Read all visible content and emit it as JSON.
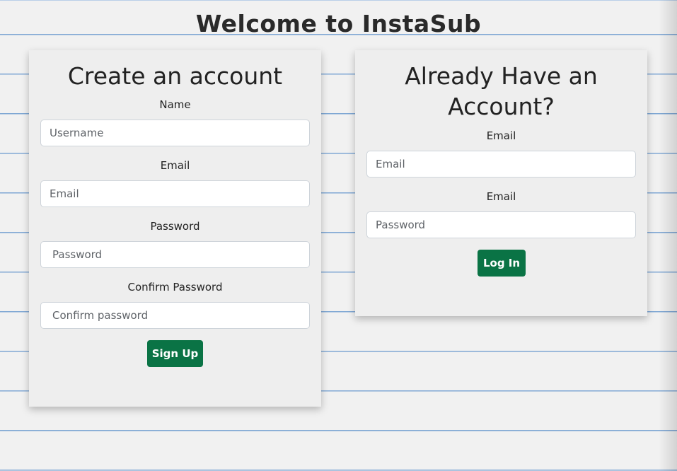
{
  "page": {
    "title": "Welcome to InstaSub"
  },
  "signup": {
    "heading": "Create an account",
    "fields": [
      {
        "label": "Name",
        "placeholder": "Username",
        "value": ""
      },
      {
        "label": "Email",
        "placeholder": "Email",
        "value": ""
      },
      {
        "label": "Password",
        "placeholder": "Password",
        "value": ""
      },
      {
        "label": "Confirm Password",
        "placeholder": "Confirm password",
        "value": ""
      }
    ],
    "submit_label": "Sign Up"
  },
  "login": {
    "heading_line1": "Already Have an",
    "heading_line2": "Account?",
    "fields": [
      {
        "label": "Email",
        "placeholder": "Email",
        "value": ""
      },
      {
        "label": "Email",
        "placeholder": "Password",
        "value": ""
      }
    ],
    "submit_label": "Log In"
  },
  "colors": {
    "button": "#0a7345",
    "card": "#eeeeee",
    "ruled_line": "#7fa7d4"
  }
}
